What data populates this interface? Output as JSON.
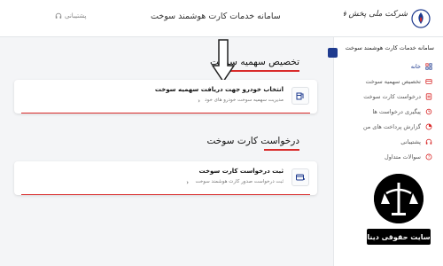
{
  "header": {
    "logo_text": "شرکت ملی پخش فرآورده های نفتی ایران",
    "title": "سامانه خدمات کارت هوشمند سوخت",
    "support_label": "پشتیبانی"
  },
  "sidebar": {
    "title": "سامانه خدمات کارت هوشمند سوخت",
    "items": [
      {
        "label": "خانه",
        "icon": "home-icon",
        "active": true
      },
      {
        "label": "تخصیص سهمیه سوخت",
        "icon": "quota-icon"
      },
      {
        "label": "درخواست کارت سوخت",
        "icon": "card-request-icon"
      },
      {
        "label": "پیگیری درخواست ها",
        "icon": "track-icon"
      },
      {
        "label": "گزارش پرداخت های من",
        "icon": "report-icon"
      },
      {
        "label": "پشتیبانی",
        "icon": "support-icon"
      },
      {
        "label": "سوالات متداول",
        "icon": "faq-icon"
      }
    ]
  },
  "sections": [
    {
      "title": "تخصیص سهمیه سوخت",
      "card": {
        "title": "انتخاب خودرو جهت دریافت سهمیه سوخت",
        "subtitle": "مدیریت سهمیه سوخت خودرو های خود"
      }
    },
    {
      "title": "درخواست کارت سوخت",
      "card": {
        "title": "ثبت درخواست کارت سوخت",
        "subtitle": "ثبت درخواست صدور کارت هوشمند سوخت"
      }
    }
  ],
  "watermark": {
    "text": "سایت حقوقی دینا"
  },
  "colors": {
    "accent": "#1f3b8f",
    "underline": "#d92b2b"
  }
}
